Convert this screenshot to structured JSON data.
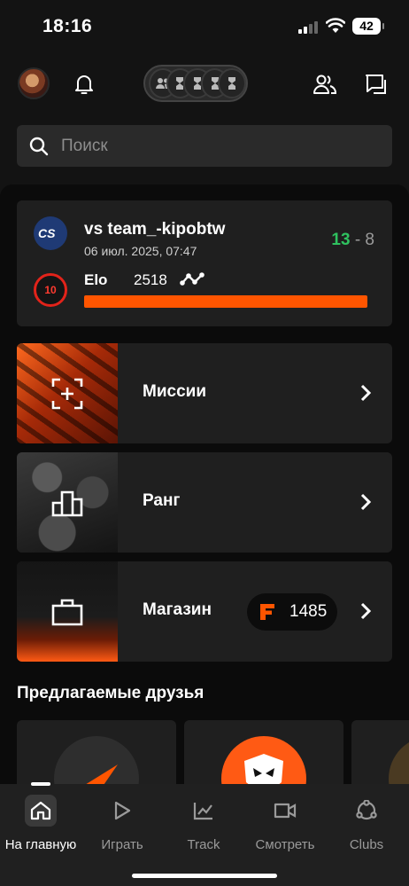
{
  "status_bar": {
    "time": "18:16",
    "battery": "42"
  },
  "search": {
    "placeholder": "Поиск"
  },
  "match": {
    "game": "cs",
    "title": "vs team_-kipobtw",
    "date": "06 июл. 2025, 07:47",
    "score_win": "13",
    "score_sep": "-",
    "score_lose": "8",
    "level": "10",
    "elo_label": "Elo",
    "elo_value": "2518",
    "elo_progress_percent": 100,
    "colors": {
      "win": "#2fc15f",
      "accent": "#ff5500",
      "level": "#e2231a"
    }
  },
  "nav_cards": [
    {
      "label": "Миссии",
      "icon": "mission-target-icon"
    },
    {
      "label": "Ранг",
      "icon": "podium-icon"
    },
    {
      "label": "Магазин",
      "icon": "briefcase-icon",
      "coins": "1485",
      "coin_icon": "faceit-coin-icon"
    }
  ],
  "suggested_friends": {
    "title": "Предлагаемые друзья"
  },
  "tabs": [
    {
      "label": "На главную",
      "icon": "home-icon",
      "active": true
    },
    {
      "label": "Играть",
      "icon": "play-icon"
    },
    {
      "label": "Track",
      "icon": "chart-icon"
    },
    {
      "label": "Смотреть",
      "icon": "video-icon"
    },
    {
      "label": "Clubs",
      "icon": "clubs-icon"
    }
  ]
}
